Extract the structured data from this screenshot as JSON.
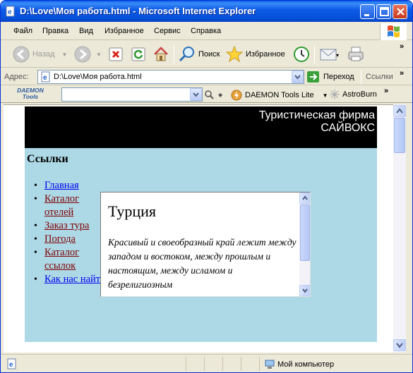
{
  "window": {
    "title": "D:\\Love\\Моя работа.html - Microsoft Internet Explorer"
  },
  "menu": [
    "Файл",
    "Правка",
    "Вид",
    "Избранное",
    "Сервис",
    "Справка"
  ],
  "toolbar": {
    "back": "Назад",
    "search": "Поиск",
    "favorites": "Избранное",
    "more": "»"
  },
  "address": {
    "label": "Адрес:",
    "value": "D:\\Love\\Моя работа.html",
    "go": "Переход",
    "links": "Ссылки",
    "more": "»"
  },
  "daemon": {
    "logo_line1": "DAEMON",
    "logo_line2": "Tools",
    "search_value": "",
    "lite": "DAEMON Tools Lite",
    "astro": "AstroBurn",
    "more": "»"
  },
  "page": {
    "brand_line1": "Туристическая фирма",
    "brand_line2": "САЙВОКС",
    "links_heading": "Ссылки",
    "nav": [
      {
        "label": "Главная",
        "visited": false
      },
      {
        "label": "Каталог отелей",
        "visited": true
      },
      {
        "label": "Заказ тура",
        "visited": true
      },
      {
        "label": "Погода",
        "visited": true
      },
      {
        "label": "Каталог ссылок",
        "visited": true
      },
      {
        "label": "Как нас найти",
        "visited": false
      }
    ],
    "frame": {
      "title": "Турция",
      "text": "Красивый и своеобразный край лежит между западом и востоком, между прошлым и настоящим, между исламом и безрелигиозным"
    }
  },
  "status": {
    "zone": "Мой компьютер"
  },
  "colors": {
    "titlebar": "#0c59e6",
    "header_bg": "#000000",
    "body_bg": "#add8e6",
    "link": "#0000ee",
    "visited": "#800000"
  }
}
